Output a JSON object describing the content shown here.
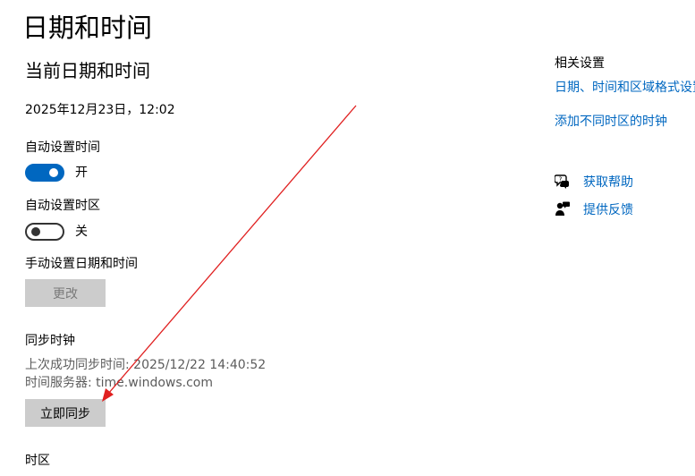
{
  "page": {
    "title": "日期和时间"
  },
  "current": {
    "section_title": "当前日期和时间",
    "datetime": "2025年12月23日，12:02"
  },
  "auto_time": {
    "label": "自动设置时间",
    "state_text": "开",
    "on": true
  },
  "auto_timezone": {
    "label": "自动设置时区",
    "state_text": "关",
    "on": false
  },
  "manual": {
    "label": "手动设置日期和时间",
    "button_label": "更改"
  },
  "sync": {
    "section_title": "同步时钟",
    "last_sync": "上次成功同步时间: 2025/12/22 14:40:52",
    "server": "时间服务器: time.windows.com",
    "button_label": "立即同步"
  },
  "timezone": {
    "section_title": "时区"
  },
  "related": {
    "title": "相关设置",
    "links": [
      "日期、时间和区域格式设置",
      "添加不同时区的时钟"
    ]
  },
  "help": {
    "get_help": "获取帮助",
    "feedback": "提供反馈"
  },
  "icons": [
    "help-chat-icon",
    "feedback-person-icon"
  ],
  "colors": {
    "accent": "#0067c0",
    "annotation_arrow": "#e02020",
    "button_bg": "#cccccc"
  }
}
